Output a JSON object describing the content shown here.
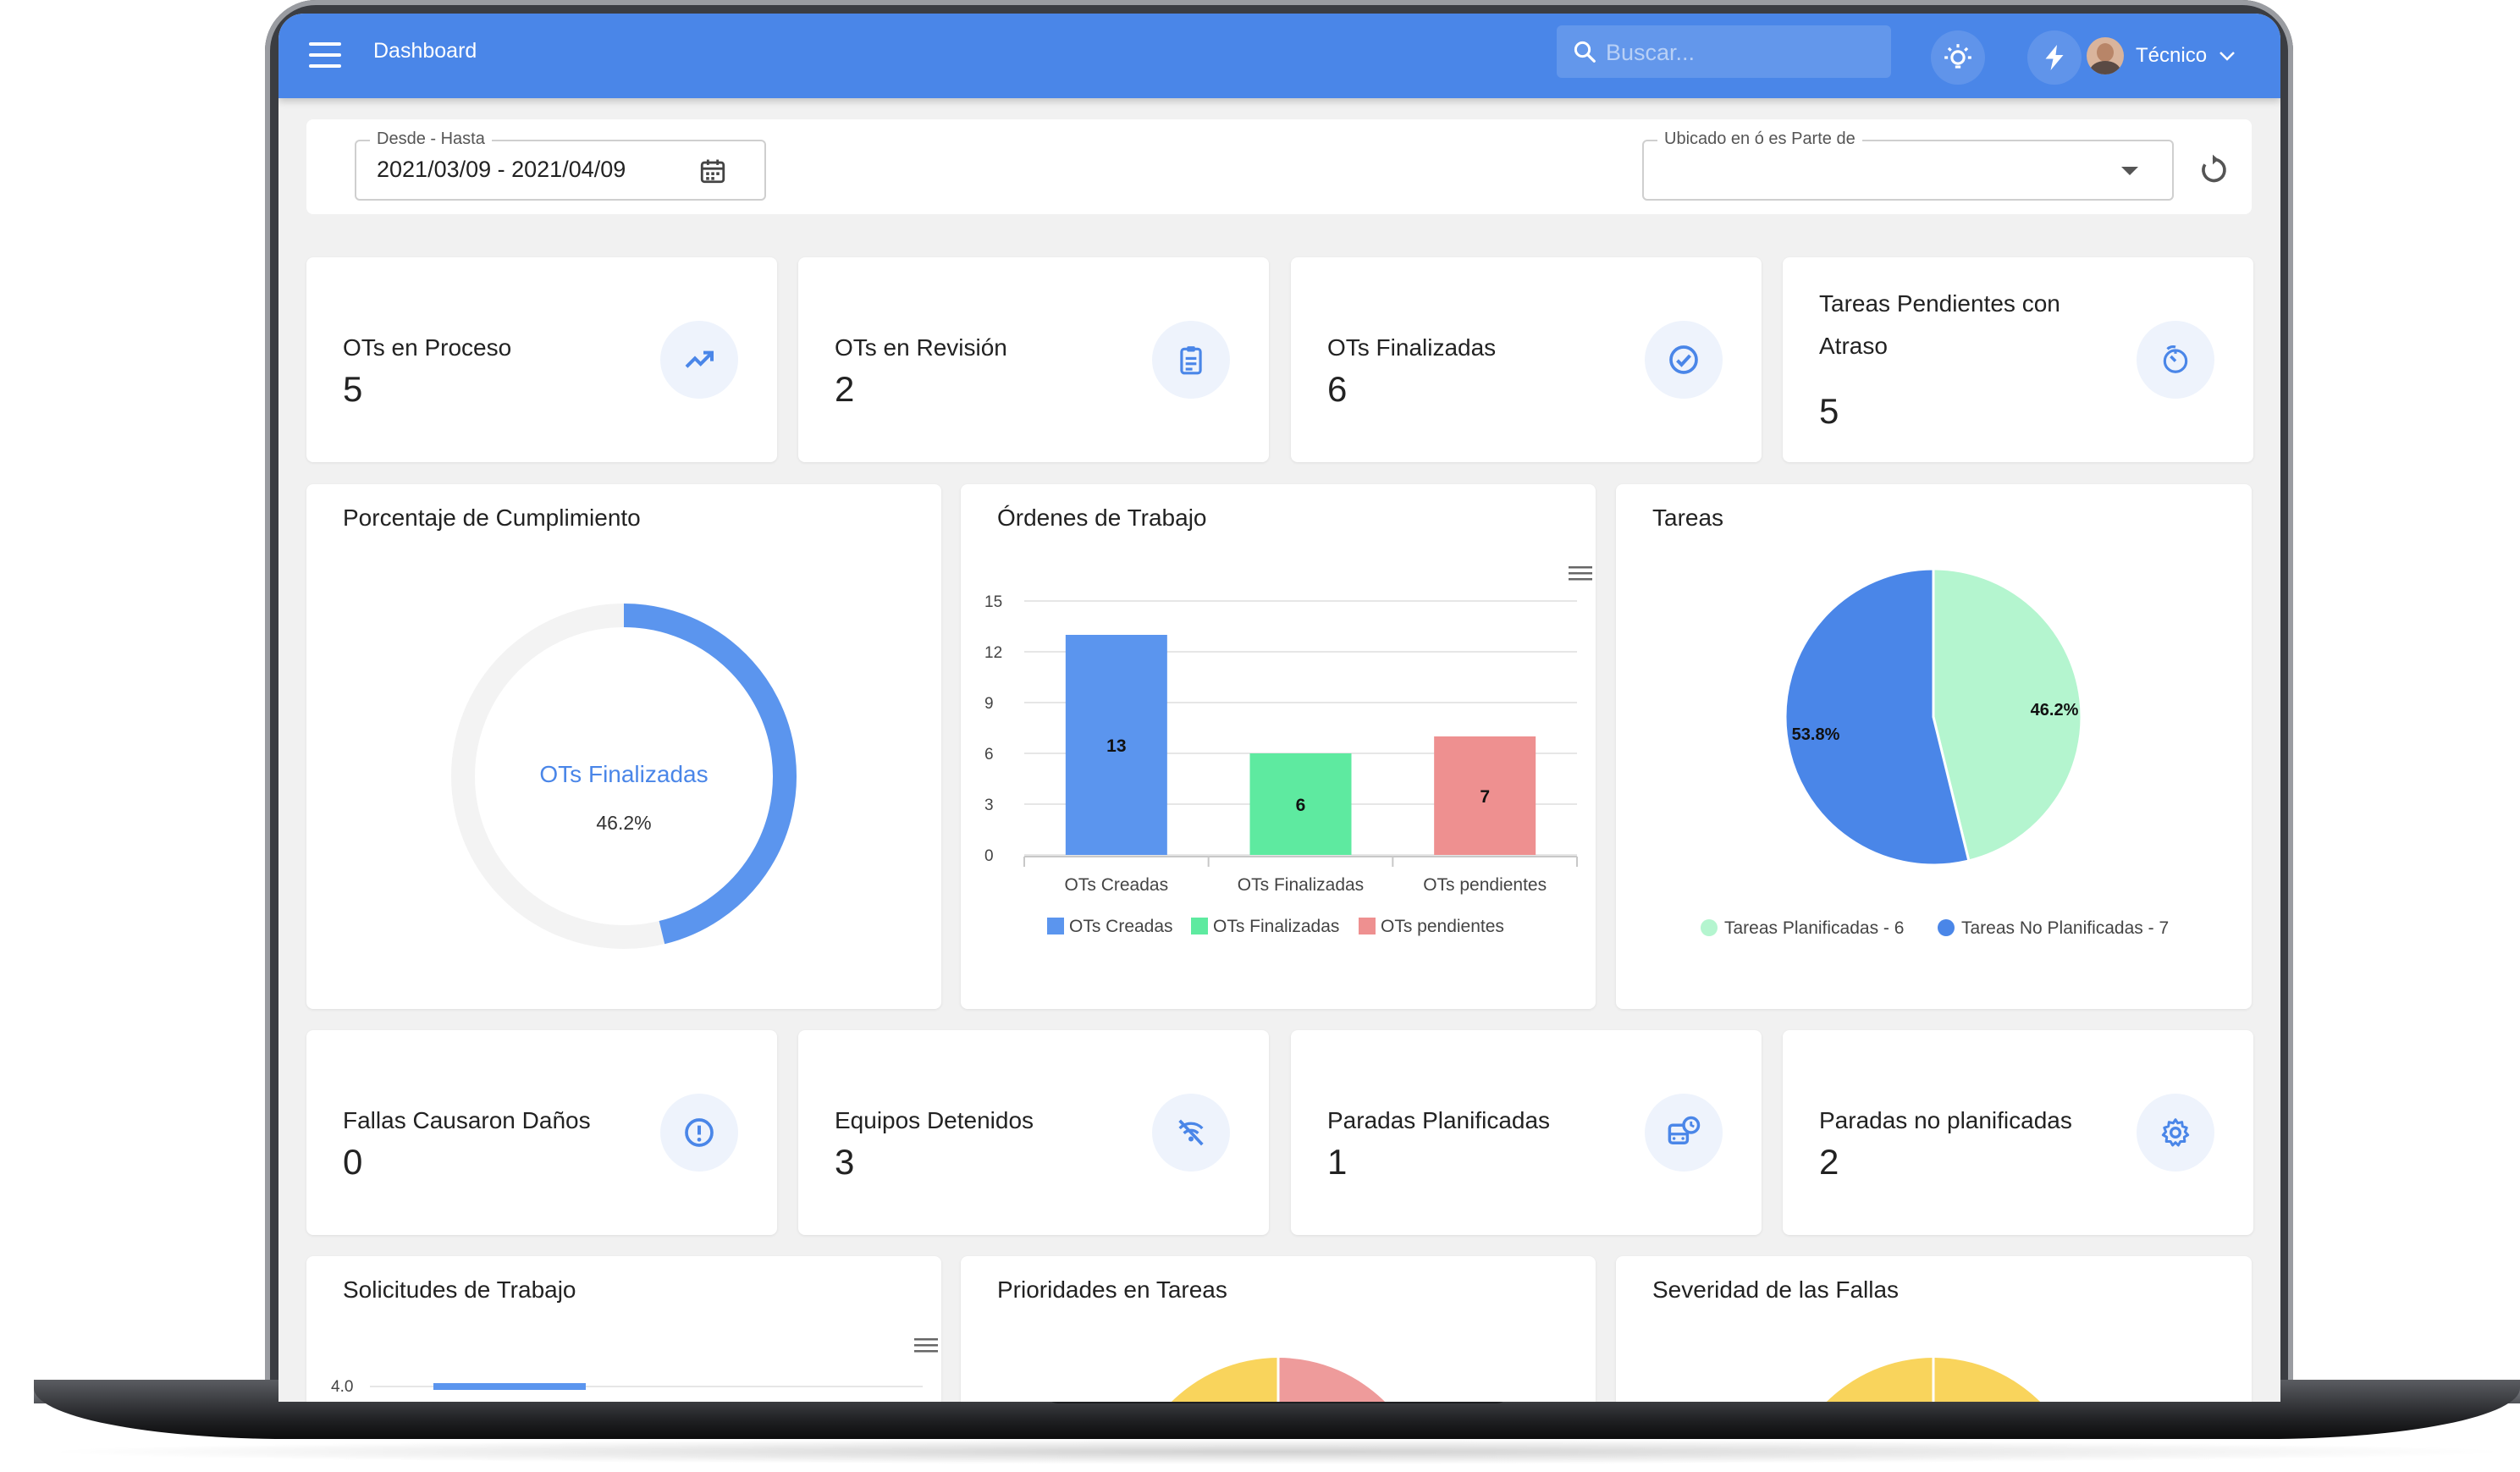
{
  "header": {
    "title": "Dashboard",
    "search_placeholder": "Buscar...",
    "user_name": "Técnico",
    "accent": "#4a86e8"
  },
  "filters": {
    "date_label": "Desde - Hasta",
    "date_value": "2021/03/09 - 2021/04/09",
    "location_label": "Ubicado en ó es Parte de",
    "location_value": ""
  },
  "stats_top": [
    {
      "label": "OTs en Proceso",
      "value": "5",
      "icon": "trending-up-icon"
    },
    {
      "label": "OTs en Revisión",
      "value": "2",
      "icon": "clipboard-icon"
    },
    {
      "label": "OTs Finalizadas",
      "value": "6",
      "icon": "check-circle-icon"
    },
    {
      "label": "Tareas Pendientes con Atraso",
      "value": "5",
      "icon": "timer-icon"
    }
  ],
  "stats_bottom": [
    {
      "label": "Fallas Causaron Daños",
      "value": "0",
      "icon": "alert-circle-icon"
    },
    {
      "label": "Equipos Detenidos",
      "value": "3",
      "icon": "stopped-icon"
    },
    {
      "label": "Paradas Planificadas",
      "value": "1",
      "icon": "bus-clock-icon"
    },
    {
      "label": "Paradas no planificadas",
      "value": "2",
      "icon": "gear-icon"
    }
  ],
  "panels": {
    "compliance_title": "Porcentaje de Cumplimiento",
    "work_orders_title": "Órdenes de Trabajo",
    "tasks_title": "Tareas",
    "requests_title": "Solicitudes de Trabajo",
    "priorities_title": "Prioridades en Tareas",
    "severity_title": "Severidad de las Fallas"
  },
  "chart_data": [
    {
      "type": "pie",
      "title": "Porcentaje de Cumplimiento",
      "center_label": "OTs Finalizadas",
      "center_value": "46.2%",
      "values": [
        46.2,
        53.8
      ],
      "colors": [
        "#5b95ee",
        "#f3f3f3"
      ]
    },
    {
      "type": "bar",
      "title": "Órdenes de Trabajo",
      "categories": [
        "OTs Creadas",
        "OTs Finalizadas",
        "OTs pendientes"
      ],
      "values": [
        13,
        6,
        7
      ],
      "colors": [
        "#5b95ee",
        "#5eeaa0",
        "#ee9090"
      ],
      "yticks": [
        "0",
        "3",
        "6",
        "9",
        "12",
        "15"
      ],
      "ylim": [
        0,
        15
      ],
      "legend": [
        "OTs Creadas",
        "OTs Finalizadas",
        "OTs pendientes"
      ],
      "legend_position": "bottom"
    },
    {
      "type": "pie",
      "title": "Tareas",
      "slices": [
        {
          "label": "46.2%",
          "value": 6,
          "color": "#b4f5cf"
        },
        {
          "label": "53.8%",
          "value": 7,
          "color": "#4a86e8"
        }
      ],
      "legend": [
        "Tareas Planificadas - 6",
        "Tareas No Planificadas - 7"
      ],
      "legend_position": "bottom"
    },
    {
      "type": "bar",
      "title": "Solicitudes de Trabajo",
      "yticks": [
        "4.0"
      ],
      "values": [
        4.0
      ],
      "colors": [
        "#5b95ee"
      ]
    },
    {
      "type": "pie",
      "title": "Prioridades en Tareas",
      "colors": [
        "#f9d45c",
        "#ee9b9b"
      ]
    },
    {
      "type": "pie",
      "title": "Severidad de las Fallas",
      "colors": [
        "#f9d45c"
      ]
    }
  ]
}
